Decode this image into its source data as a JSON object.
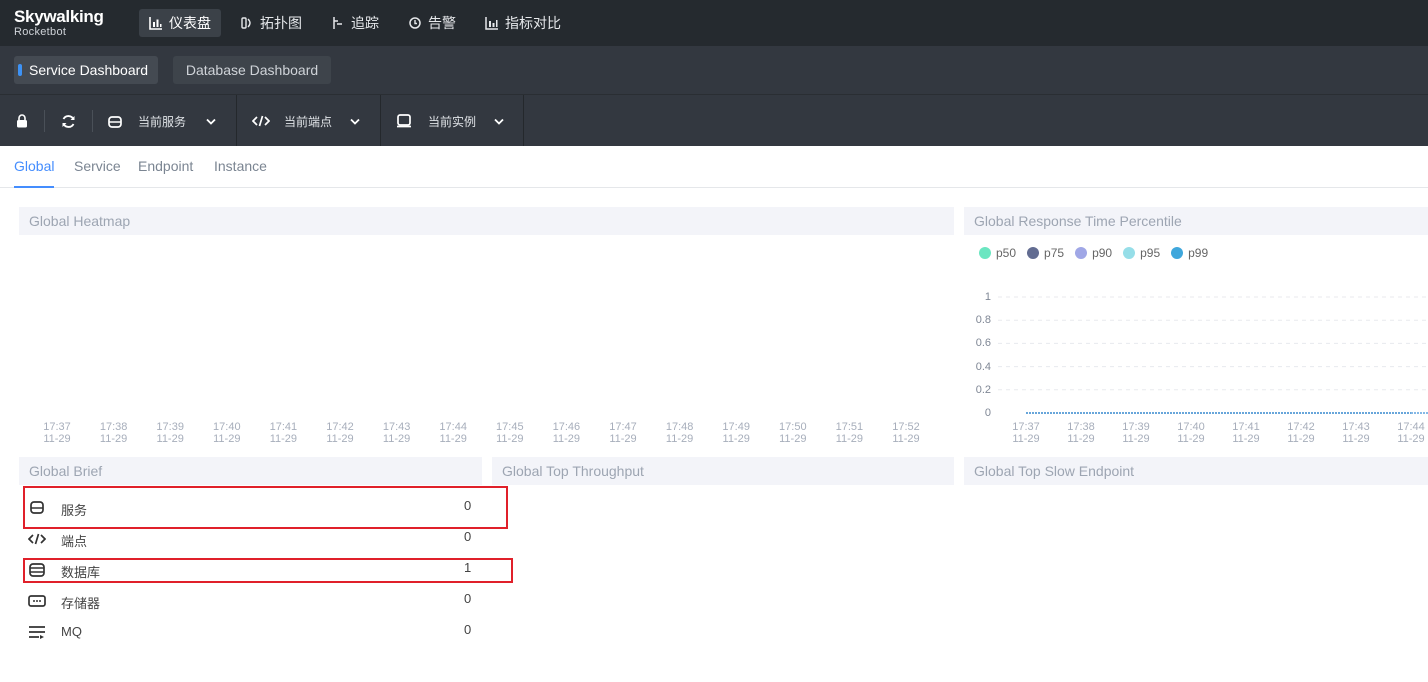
{
  "app": {
    "brand": "Skywalking",
    "sub": "Rocketbot"
  },
  "nav": [
    {
      "label": "仪表盘",
      "icon": "chart-icon",
      "active": true
    },
    {
      "label": "拓扑图",
      "icon": "topology-icon"
    },
    {
      "label": "追踪",
      "icon": "trace-icon"
    },
    {
      "label": "告警",
      "icon": "alarm-icon"
    },
    {
      "label": "指标对比",
      "icon": "compare-icon"
    }
  ],
  "dashboards": {
    "active": "Service Dashboard",
    "other": "Database Dashboard"
  },
  "toolbar": {
    "service": "当前服务",
    "endpoint": "当前端点",
    "instance": "当前实例"
  },
  "subtabs": [
    "Global",
    "Service",
    "Endpoint",
    "Instance"
  ],
  "panels": {
    "heatmap": "Global Heatmap",
    "percentile": "Global Response Time Percentile",
    "brief": "Global Brief",
    "throughput": "Global Top Throughput",
    "slow": "Global Top Slow Endpoint"
  },
  "heatmap_ticks": [
    "17:37",
    "17:38",
    "17:39",
    "17:40",
    "17:41",
    "17:42",
    "17:43",
    "17:44",
    "17:45",
    "17:46",
    "17:47",
    "17:48",
    "17:49",
    "17:50",
    "17:51",
    "17:52"
  ],
  "tick_date": "11-29",
  "chart_data": {
    "type": "line",
    "title": "Global Response Time Percentile",
    "x": [
      "17:37",
      "17:38",
      "17:39",
      "17:40",
      "17:41",
      "17:42",
      "17:43",
      "17:44"
    ],
    "x_sub": "11-29",
    "ylim": [
      0,
      1
    ],
    "yticks": [
      "1",
      "0.8",
      "0.6",
      "0.4",
      "0.2",
      "0"
    ],
    "grid": true,
    "legend_position": "top-left",
    "series": [
      {
        "name": "p50",
        "color": "#6be6c1",
        "values": [
          0,
          0,
          0,
          0,
          0,
          0,
          0,
          0
        ]
      },
      {
        "name": "p75",
        "color": "#626c91",
        "values": [
          0,
          0,
          0,
          0,
          0,
          0,
          0,
          0
        ]
      },
      {
        "name": "p90",
        "color": "#a0a7e6",
        "values": [
          0,
          0,
          0,
          0,
          0,
          0,
          0,
          0
        ]
      },
      {
        "name": "p95",
        "color": "#96dee8",
        "values": [
          0,
          0,
          0,
          0,
          0,
          0,
          0,
          0
        ]
      },
      {
        "name": "p99",
        "color": "#3fa7dc",
        "values": [
          0,
          0,
          0,
          0,
          0,
          0,
          0,
          0
        ]
      }
    ]
  },
  "brief": [
    {
      "label": "服务",
      "value": "0",
      "icon": "service-icon",
      "highlight": true
    },
    {
      "label": "端点",
      "value": "0",
      "icon": "endpoint-icon",
      "highlight": false
    },
    {
      "label": "数据库",
      "value": "1",
      "icon": "database-icon",
      "highlight": true
    },
    {
      "label": "存储器",
      "value": "0",
      "icon": "storage-icon",
      "highlight": false
    },
    {
      "label": "MQ",
      "value": "0",
      "icon": "mq-icon",
      "highlight": false
    }
  ],
  "colors": {
    "accent": "#448dfe",
    "topbar": "#252a2f",
    "highlight_box": "#e0202a"
  }
}
